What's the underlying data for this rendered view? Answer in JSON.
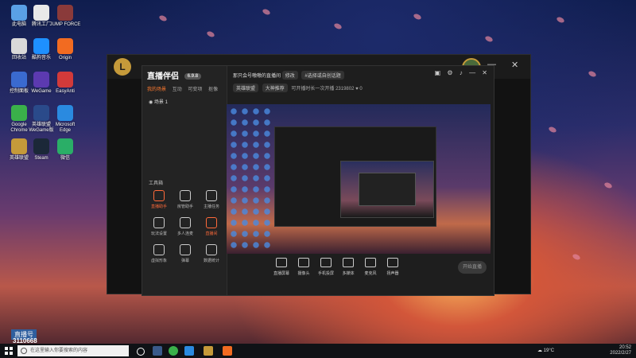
{
  "desktop": {
    "icons": [
      {
        "label": "此电脑",
        "color": "#5aa0e6"
      },
      {
        "label": "腾讯工厂",
        "color": "#e9e9e9"
      },
      {
        "label": "JUMP FORCE",
        "color": "#8a3a3a"
      },
      {
        "label": "回收站",
        "color": "#d9d9d9"
      },
      {
        "label": "酷狗音乐",
        "color": "#1e90ff"
      },
      {
        "label": "Origin",
        "color": "#f26b21"
      },
      {
        "label": "控制面板",
        "color": "#3a6ad0"
      },
      {
        "label": "WeGame",
        "color": "#5c3ab0"
      },
      {
        "label": "EasyAnti",
        "color": "#d23a3a"
      },
      {
        "label": "Google Chrome",
        "color": "#3ab04a"
      },
      {
        "label": "英雄联盟 WeGame版",
        "color": "#2a4a8a"
      },
      {
        "label": "Microsoft Edge",
        "color": "#2a8ae0"
      },
      {
        "label": "英雄联盟",
        "color": "#c59a3a"
      },
      {
        "label": "Steam",
        "color": "#1b2838"
      },
      {
        "label": "微信",
        "color": "#2aae67"
      }
    ]
  },
  "main_window": {
    "title_icon": "L",
    "minimize": "—",
    "close": "✕"
  },
  "tool": {
    "logo": "直播伴侣",
    "badge": "6.9.8",
    "tabs": [
      "我的场景",
      "互动",
      "可变项",
      "抠像"
    ],
    "scene": "场景 1",
    "tools_title": "工具箱",
    "tools": [
      {
        "label": "直播助手",
        "hot": true
      },
      {
        "label": "房管助手",
        "hot": false
      },
      {
        "label": "主播任务",
        "hot": false
      },
      {
        "label": "玩法设置",
        "hot": false
      },
      {
        "label": "多人连麦",
        "hot": false
      },
      {
        "label": "直播间",
        "hot": true
      },
      {
        "label": "虚拟形象",
        "hot": false
      },
      {
        "label": "弹幕",
        "hot": false
      },
      {
        "label": "数据统计",
        "hot": false
      }
    ],
    "room_title": "那只会号嗷嗷的直播间",
    "room_chip1": "修改",
    "room_chip2": "#选择或自创话题",
    "meta_chip1": "英雄联盟",
    "meta_chip2": "大神推荐",
    "meta_text": "可开播时长一次开播",
    "meta_num": "2319802",
    "meta_likes": "0",
    "controls": [
      {
        "label": "直播屏幕"
      },
      {
        "label": "摄像头"
      },
      {
        "label": "手机投屏"
      },
      {
        "label": "多媒体"
      },
      {
        "label": "麦克风"
      },
      {
        "label": "扬声器"
      }
    ],
    "start": "开始直播"
  },
  "watermark": {
    "label": "直播号",
    "number": "3110668"
  },
  "taskbar": {
    "search_placeholder": "在这里输入你要搜索的内容",
    "weather": "19°C",
    "time": "20:52",
    "date": "2022/2/27",
    "lang": "中"
  }
}
